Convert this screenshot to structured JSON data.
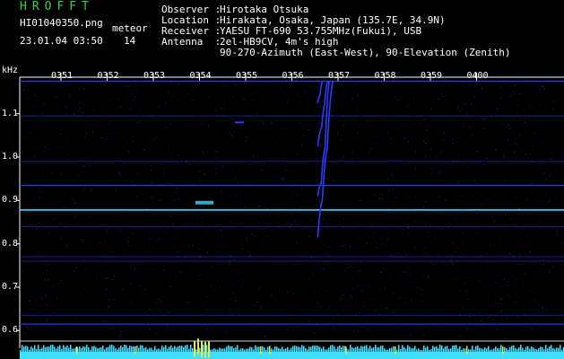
{
  "header": {
    "app_title": "HROFFT",
    "filename": "HI01040350.png",
    "meteor_label": "meteor",
    "timestamp": "23.01.04 03:50",
    "meteor_count": "14"
  },
  "station": {
    "observer_key": "Observer :",
    "observer_val": "Hirotaka Otsuka",
    "location_key": "Location :",
    "location_val": "Hirakata, Osaka, Japan (135.7E, 34.9N)",
    "receiver_key": "Receiver :",
    "receiver_val": "YAESU FT-690 53.755MHz(Fukui), USB",
    "antenna_key": "Antenna  :",
    "antenna_val": "2el-HB9CV, 4m's high",
    "antenna_val2": "90-270-Azimuth (East-West), 90-Elevation (Zenith)"
  },
  "colors": {
    "title_green": "#2fd24a",
    "signal_blue": "#2a3cff",
    "signal_cyan": "#3fd4ff",
    "grid_white": "#ffffff",
    "baseline_cyan": "#3fe0ff",
    "burst_yellow": "#e8e84a"
  },
  "chart_data": {
    "type": "spectrogram",
    "ylabel": "kHz",
    "x_ticks": [
      "0351",
      "0352",
      "0353",
      "0354",
      "0355",
      "0356",
      "0357",
      "0358",
      "0359",
      "0400"
    ],
    "y_ticks": [
      "1.1",
      "1.0",
      "0.9",
      "0.8",
      "0.7",
      "0.6"
    ],
    "ylim": [
      0.6,
      1.18
    ],
    "horizontal_carriers_khz": [
      1.175,
      0.935,
      0.878,
      0.615
    ],
    "faint_lines_khz": [
      1.095,
      0.99,
      0.84,
      0.77,
      0.76,
      0.635
    ],
    "meteor_traces": [
      {
        "name": "",
        "points": [
          [
            0.5475,
            1.125
          ],
          [
            0.552,
            1.145
          ],
          [
            0.5567,
            1.175
          ]
        ]
      },
      {
        "name": "",
        "points": [
          [
            0.5475,
            1.025
          ],
          [
            0.555,
            1.07
          ],
          [
            0.56,
            1.12
          ],
          [
            0.566,
            1.175
          ]
        ]
      },
      {
        "name": "",
        "points": [
          [
            0.5475,
            0.91
          ],
          [
            0.554,
            0.94
          ],
          [
            0.561,
            1.02
          ],
          [
            0.569,
            1.175
          ]
        ]
      },
      {
        "name": "",
        "points": [
          [
            0.5475,
            0.815
          ],
          [
            0.556,
            0.9
          ],
          [
            0.565,
            1.02
          ],
          [
            0.5755,
            1.175
          ]
        ]
      }
    ],
    "echo_burst": {
      "x": 0.5535,
      "khz": 0.895
    }
  }
}
